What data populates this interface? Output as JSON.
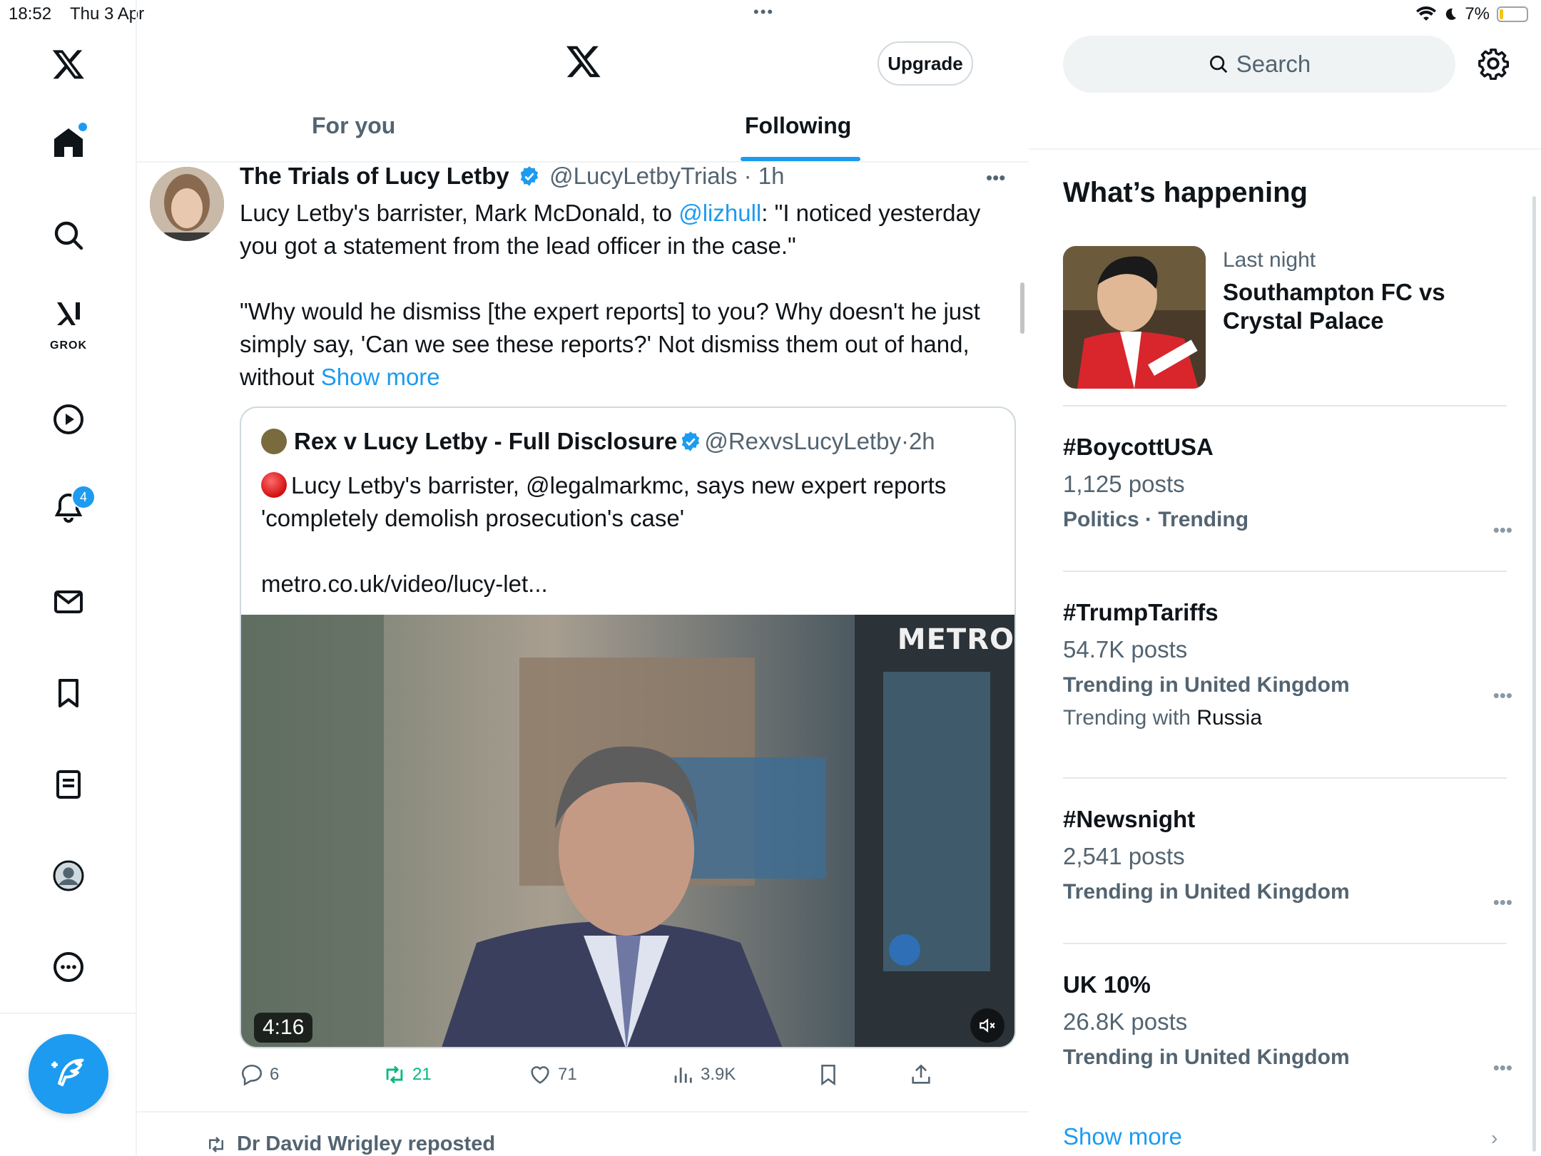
{
  "status_bar": {
    "time": "18:52",
    "date": "Thu 3 Apr",
    "battery": "7%"
  },
  "left_nav": {
    "notifications_badge": "4",
    "grok_label": "GROK"
  },
  "header": {
    "upgrade_label": "Upgrade",
    "tabs": [
      "For you",
      "Following"
    ],
    "active_tab": "Following"
  },
  "post": {
    "author_name": "The Trials of Lucy Letby",
    "handle": "@LucyLetbyTrials",
    "time": "1h",
    "text_part1": "Lucy Letby's barrister, Mark McDonald, to ",
    "mention": "@lizhull",
    "text_part2": ": \"I noticed yesterday you got a statement from the lead officer in the case.\"",
    "text_para2": "\"Why would he dismiss [the expert reports] to you? Why doesn't he just simply say, 'Can we see these reports?' Not dismiss them out of hand, without ",
    "show_more": "Show more",
    "quote": {
      "author_name": "Rex v Lucy Letby - Full Disclosure",
      "handle": "@RexvsLucyLetby",
      "time": "2h",
      "text": "Lucy Letby's barrister, @legalmarkmc, says new expert reports 'completely demolish prosecution's case'",
      "link": "metro.co.uk/video/lucy-let...",
      "video_brand": "METRO",
      "video_duration": "4:16"
    },
    "actions": {
      "replies": "6",
      "reposts": "21",
      "likes": "71",
      "views": "3.9K"
    }
  },
  "next_post": {
    "repost_line": "Dr David Wrigley reposted"
  },
  "sidebar": {
    "search_placeholder": "Search",
    "section_title": "What’s happening",
    "featured": {
      "subtitle": "Last night",
      "title": "Southampton FC vs Crystal Palace"
    },
    "trends": [
      {
        "name": "#BoycottUSA",
        "posts": "1,125 posts",
        "category": "Politics · Trending"
      },
      {
        "name": "#TrumpTariffs",
        "posts": "54.7K posts",
        "category": "Trending in United Kingdom",
        "with_label": "Trending with",
        "with_value": "Russia"
      },
      {
        "name": "#Newsnight",
        "posts": "2,541 posts",
        "category": "Trending in United Kingdom"
      },
      {
        "name": "UK 10%",
        "posts": "26.8K posts",
        "category": "Trending in United Kingdom"
      }
    ],
    "show_more": "Show more"
  },
  "colors": {
    "accent": "#1d9bf0",
    "repost": "#00ba7c",
    "text": "#0f1419",
    "muted": "#536471"
  }
}
